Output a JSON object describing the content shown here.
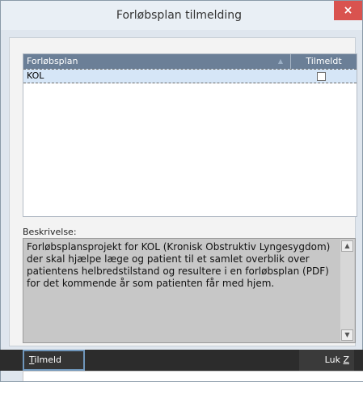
{
  "window": {
    "title": "Forløbsplan tilmelding",
    "close_label": "×"
  },
  "grid": {
    "columns": [
      "Forløbsplan",
      "Tilmeldt"
    ],
    "sort_icon": "sort-ascending-icon",
    "rows": [
      {
        "plan": "KOL",
        "tilmeldt": false
      }
    ]
  },
  "description": {
    "label": "Beskrivelse:",
    "text": "Forløbsplansprojekt for KOL (Kronisk Obstruktiv Lyngesygdom) der skal hjælpe læge og patient til et samlet overblik over patientens helbredstilstand og resultere i en forløbsplan (PDF) for det kommende år som patienten får med hjem."
  },
  "buttons": {
    "tilmeld_prefix": "T",
    "tilmeld_rest": "ilmeld",
    "luk_prefix": "Luk ",
    "luk_key": "Z"
  },
  "colors": {
    "header": "#6b7f97",
    "selected_row": "#d6e6f7",
    "close_button": "#d9534f",
    "bottom_bar": "#2c2c2c"
  }
}
